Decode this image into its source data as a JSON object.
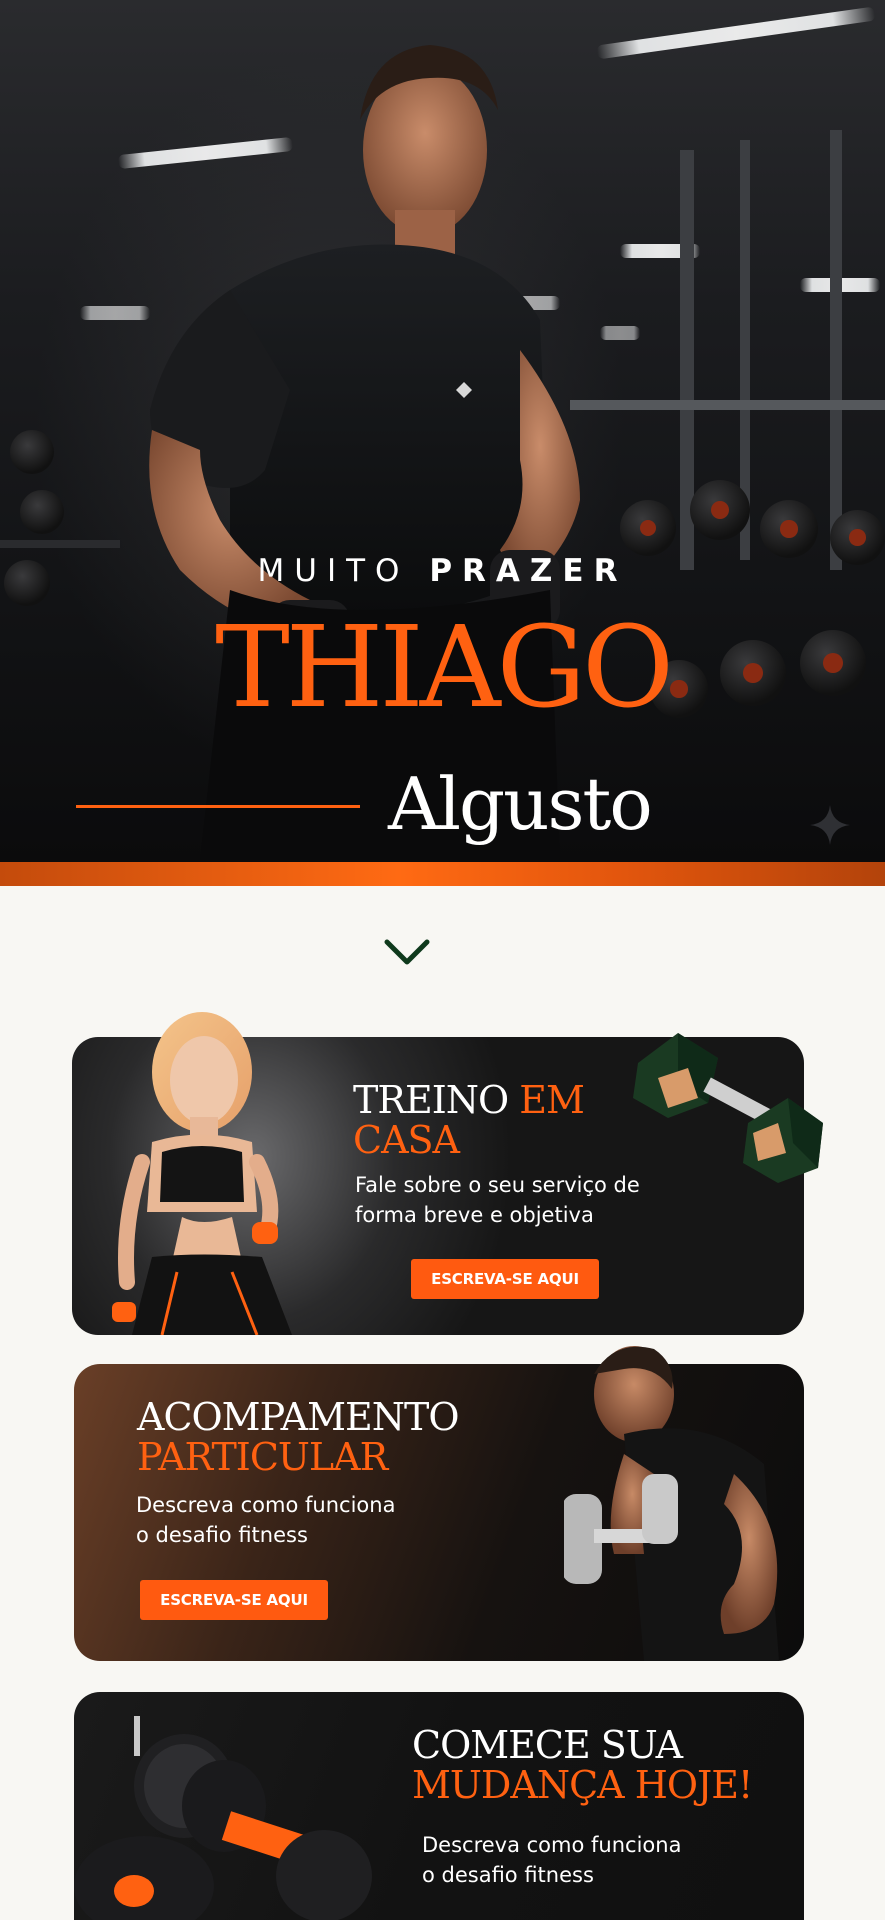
{
  "hero": {
    "greeting_regular": "MUITO",
    "greeting_bold": "PRAZER",
    "first_name": "THIAGO",
    "last_name": "Algusto"
  },
  "cards": [
    {
      "title_line1": "TREINO",
      "title_accent1": "EM",
      "title_line2_accent": "CASA",
      "description_line1": "Fale sobre o seu serviço de",
      "description_line2": "forma breve e objetiva",
      "cta": "ESCREVA-SE AQUI"
    },
    {
      "title_line1": "ACOMPAMENTO",
      "title_line2_accent": "PARTICULAR",
      "description_line1": "Descreva como funciona",
      "description_line2": "o desafio fitness",
      "cta": "ESCREVA-SE AQUI"
    },
    {
      "title_line1": "COMECE SUA",
      "title_line2_accent": "MUDANÇA HOJE!",
      "description_line1": "Descreva como funciona",
      "description_line2": "o desafio fitness"
    }
  ],
  "colors": {
    "accent": "#ff6111",
    "card_dark": "#151515",
    "chevron": "#0f3a1c",
    "page_bg": "#f8f7f3"
  }
}
